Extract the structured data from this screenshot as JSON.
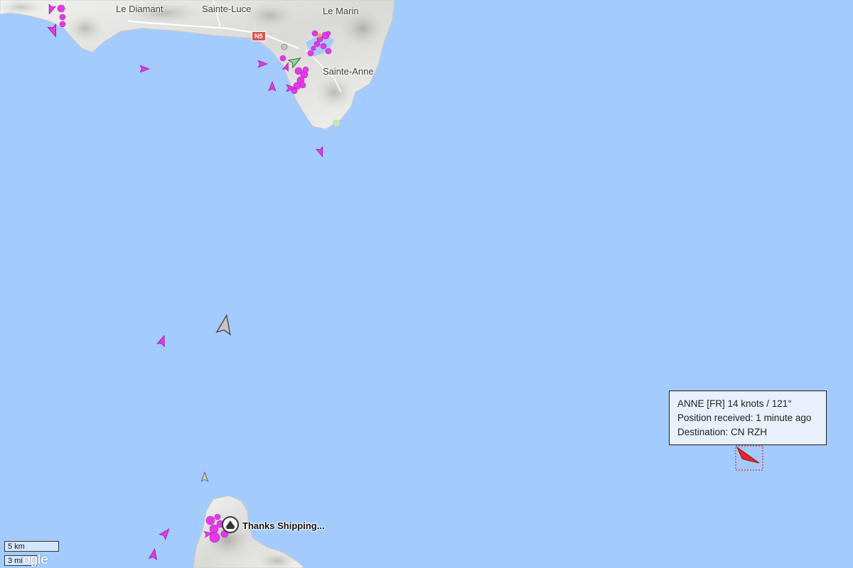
{
  "map": {
    "places": {
      "le_diamant": "Le Diamant",
      "sainte_luce": "Sainte-Luce",
      "le_marin": "Le Marin",
      "sainte_anne": "Sainte-Anne"
    },
    "road_badge": "N5"
  },
  "vessel_popup": {
    "line1": "ANNE [FR] 14 knots / 121°",
    "line2": "Position received: 1 minute ago",
    "line3": "Destination: CN RZH"
  },
  "station": {
    "label": "Thanks Shipping..."
  },
  "scale": {
    "km": "5 km",
    "mi": "3 mi"
  },
  "attribution": "ogle",
  "colors": {
    "sea": "#a3cbfd",
    "land": "#ededeb",
    "selected_vessel": "#e8262b",
    "passenger_vessel": "#e33ae5",
    "unknown_vessel": "#c7c7c7",
    "cargo_vessel": "#7de38f"
  }
}
